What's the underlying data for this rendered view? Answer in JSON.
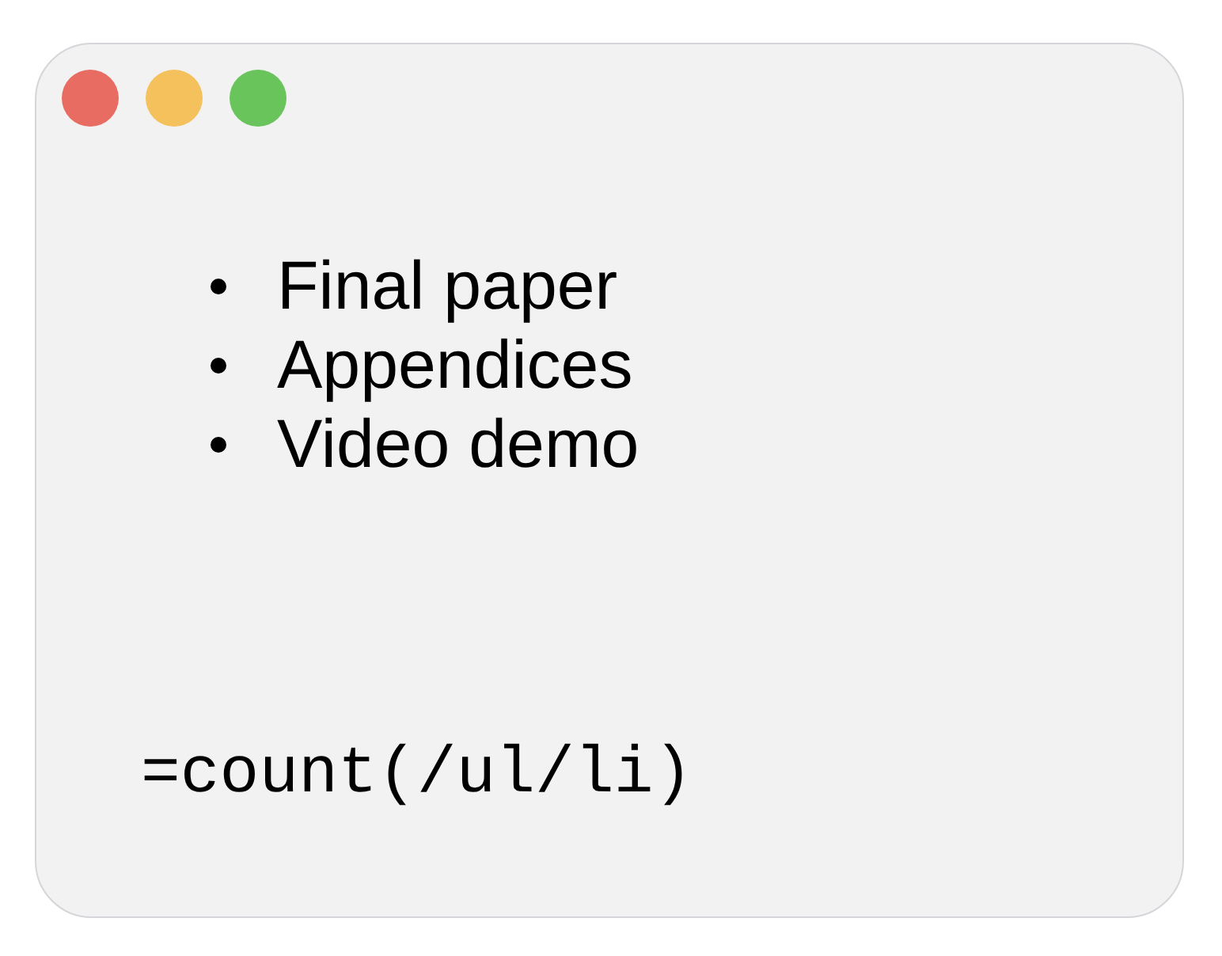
{
  "list": {
    "items": [
      "Final paper",
      "Appendices",
      "Video demo"
    ]
  },
  "formula": "=count(/ul/li)"
}
